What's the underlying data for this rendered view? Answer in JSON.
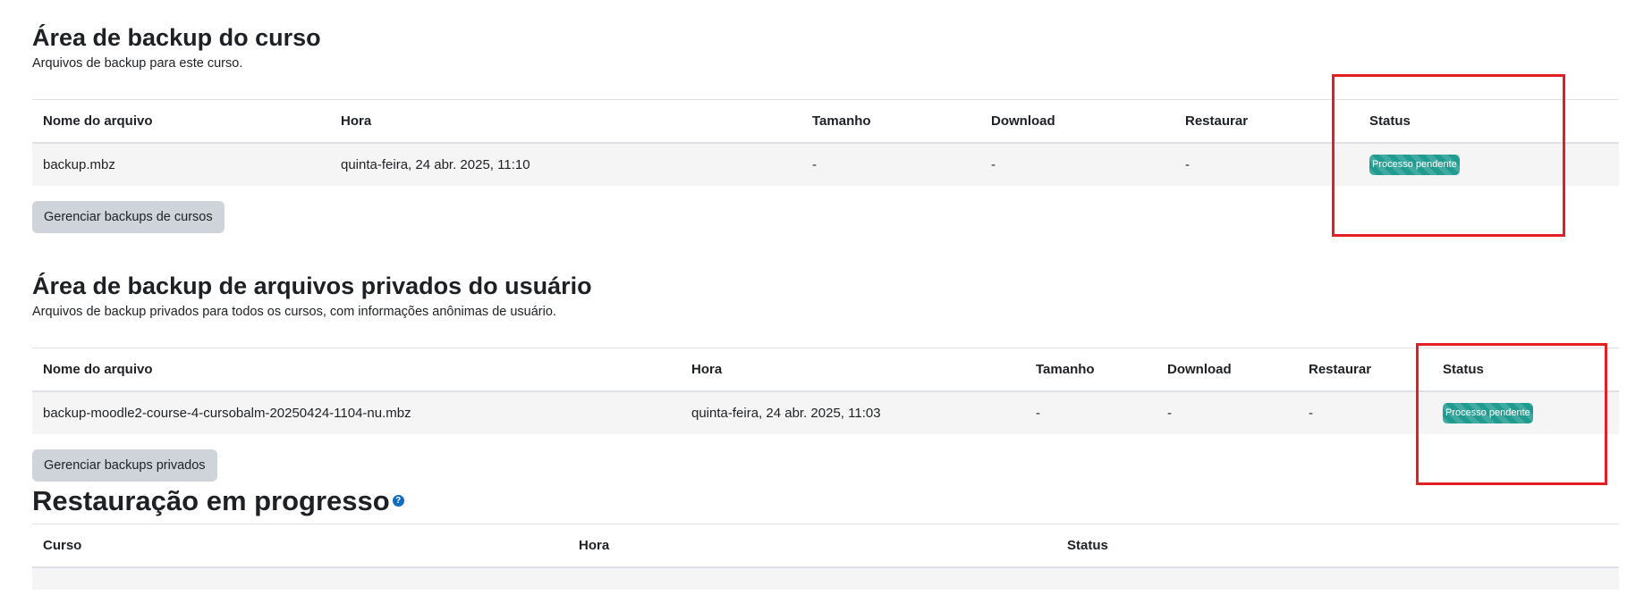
{
  "course_backup": {
    "title": "Área de backup do curso",
    "description": "Arquivos de backup para este curso.",
    "columns": [
      "Nome do arquivo",
      "Hora",
      "Tamanho",
      "Download",
      "Restaurar",
      "Status"
    ],
    "rows": [
      {
        "filename": "backup.mbz",
        "time": "quinta-feira, 24 abr. 2025, 11:10",
        "size": "-",
        "download": "-",
        "restore": "-",
        "status": "Processo pendente"
      }
    ],
    "manage_button": "Gerenciar backups de cursos"
  },
  "private_backup": {
    "title": "Área de backup de arquivos privados do usuário",
    "description": "Arquivos de backup privados para todos os cursos, com informações anônimas de usuário.",
    "columns": [
      "Nome do arquivo",
      "Hora",
      "Tamanho",
      "Download",
      "Restaurar",
      "Status"
    ],
    "rows": [
      {
        "filename": "backup-moodle2-course-4-cursobalm-20250424-1104-nu.mbz",
        "time": "quinta-feira, 24 abr. 2025, 11:03",
        "size": "-",
        "download": "-",
        "restore": "-",
        "status": "Processo pendente"
      }
    ],
    "manage_button": "Gerenciar backups privados"
  },
  "restore_progress": {
    "title": "Restauração em progresso",
    "help_icon": "question-circle-icon",
    "columns": [
      "Curso",
      "Hora",
      "Status"
    ]
  },
  "colors": {
    "badge": "#1f9b8f",
    "highlight": "#e31e24",
    "button": "#ced4da",
    "row_bg": "#f5f5f5"
  }
}
